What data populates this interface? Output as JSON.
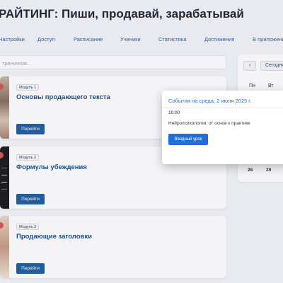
{
  "header": {
    "title": "РАЙТИНГ: Пиши, продавай, зарабатывай"
  },
  "nav": {
    "items": [
      "Настройки",
      "Доступ",
      "Расписание",
      "Ученики",
      "Статистика",
      "Достижения",
      "В приложении"
    ]
  },
  "search": {
    "placeholder": "тренингов..."
  },
  "modules": [
    {
      "badge": "Модуль 1",
      "title": "Основы продающего текста",
      "button": "Перейти"
    },
    {
      "badge": "Модуль 2",
      "title": "Формулы убеждения",
      "button": "Перейти"
    },
    {
      "badge": "Модуль 3",
      "title": "Продающие заголовки",
      "button": "Перейти"
    }
  ],
  "calendar": {
    "prev_label": "‹",
    "today_label": "Сегодня",
    "weekdays": [
      "Пн",
      "Вт"
    ],
    "days": [
      "28",
      "29"
    ]
  },
  "modal": {
    "title": "События на среда, 2 июля 2025 г.",
    "time": "10:00",
    "event": "Нейропсихология: от основ к практике",
    "button": "Вводный урок"
  },
  "colors": {
    "accent": "#1f5f9f",
    "modal_button": "#1f6fd6",
    "link": "#2a6fc0"
  }
}
